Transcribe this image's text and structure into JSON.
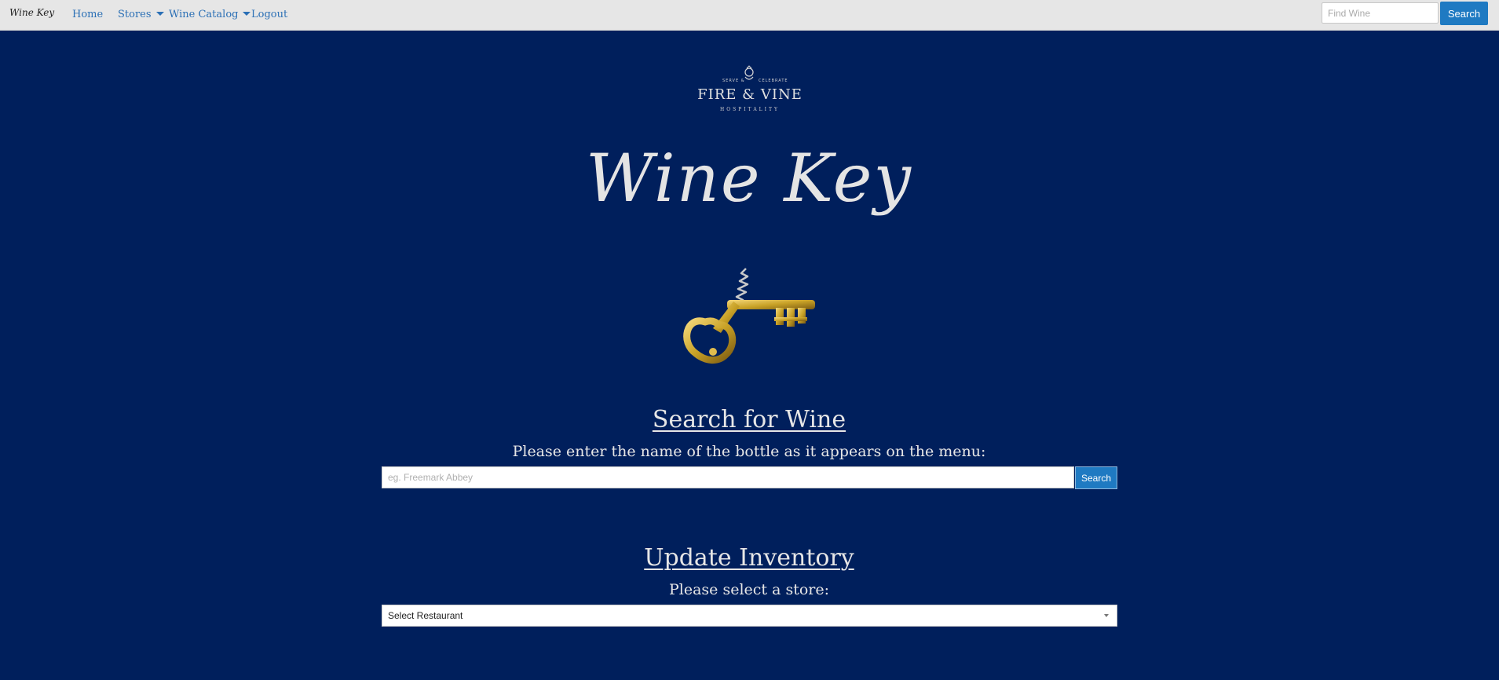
{
  "navbar": {
    "brand": "Wine Key",
    "links": [
      {
        "label": "Home",
        "dropdown": false
      },
      {
        "label": "Stores",
        "dropdown": true
      },
      {
        "label": "Wine Catalog",
        "dropdown": true
      },
      {
        "label": "Logout",
        "dropdown": false
      }
    ],
    "search": {
      "placeholder": "Find Wine",
      "button_label": "Search"
    }
  },
  "logo": {
    "tagline_left": "SERVE &",
    "tagline_right": "CELEBRATE",
    "name": "FIRE & VINE",
    "subtitle": "HOSPITALITY"
  },
  "hero": {
    "title": "Wine Key",
    "illustration": "corkscrew-key-icon"
  },
  "search_section": {
    "title": "Search for Wine",
    "instruction": "Please enter the name of the bottle as it appears on the menu:",
    "input_placeholder": "eg. Freemark Abbey",
    "button_label": "Search"
  },
  "inventory_section": {
    "title": "Update Inventory",
    "instruction": "Please select a store:",
    "select_value": "Select Restaurant"
  },
  "colors": {
    "background": "#001f5c",
    "navbar": "#e6e6e6",
    "link": "#2a6fb5",
    "button": "#1f7ac2",
    "text_light": "#e6e6e6",
    "gold": "#c9a227"
  }
}
